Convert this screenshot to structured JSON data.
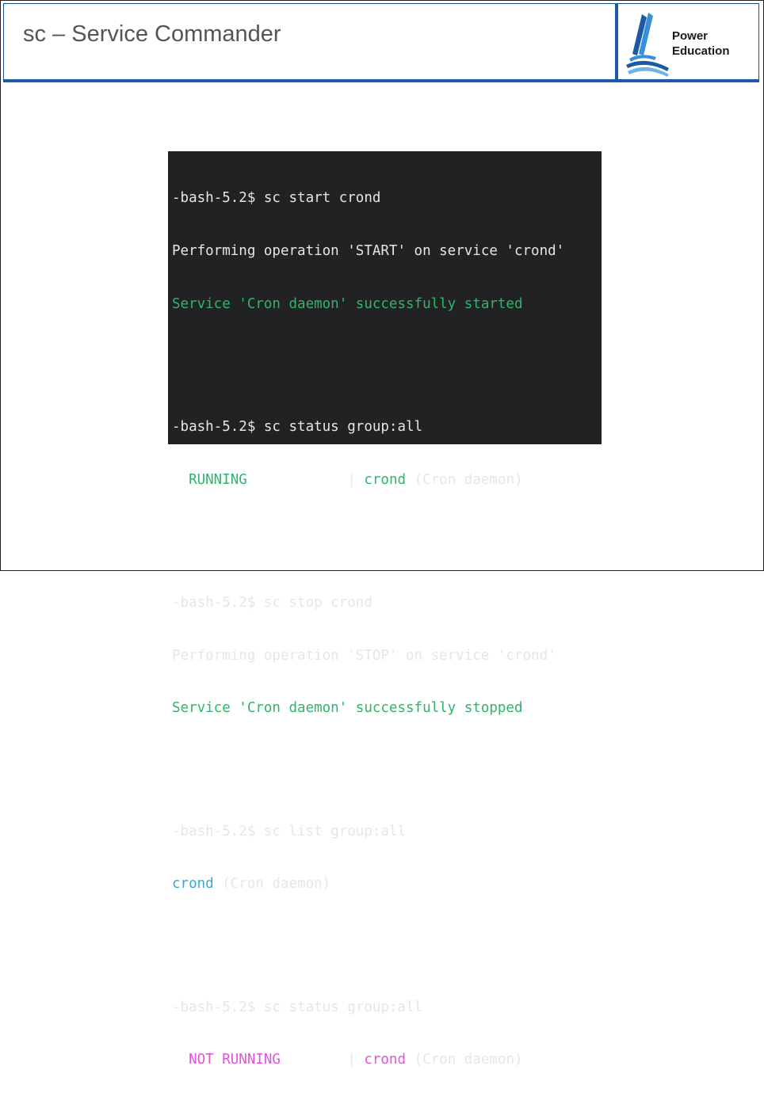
{
  "slide": {
    "title": "sc – Service Commander",
    "logo": {
      "line1": "Power",
      "line2": "Education"
    }
  },
  "terminal": {
    "blocks": [
      {
        "prompt": "-bash-5.2$ sc start crond",
        "output": [
          {
            "text": "Performing operation 'START' on service 'crond'"
          },
          {
            "text": "Service 'Cron daemon' successfully started",
            "color": "green"
          }
        ]
      },
      {
        "prompt": "-bash-5.2$ sc status group:all",
        "status": {
          "state": "  RUNNING",
          "sep": "            | ",
          "name": "crond",
          "desc": " (Cron daemon)"
        }
      },
      {
        "prompt": "-bash-5.2$ sc stop crond",
        "output": [
          {
            "text": "Performing operation 'STOP' on service 'crond'"
          },
          {
            "text": "Service 'Cron daemon' successfully stopped",
            "color": "green"
          }
        ]
      },
      {
        "prompt": "-bash-5.2$ sc list group:all",
        "list": {
          "name": "crond",
          "desc": " (Cron daemon)"
        }
      },
      {
        "prompt": "-bash-5.2$ sc status group:all",
        "status": {
          "state": "  NOT RUNNING",
          "sep": "        | ",
          "name": "crond",
          "desc": " (Cron daemon)"
        }
      }
    ]
  },
  "colors": {
    "header_rule": "#1c5aa3",
    "terminal_bg": "#222224",
    "green": "#2fb56b",
    "cyan": "#3aa7d6",
    "magenta": "#e052d8"
  }
}
